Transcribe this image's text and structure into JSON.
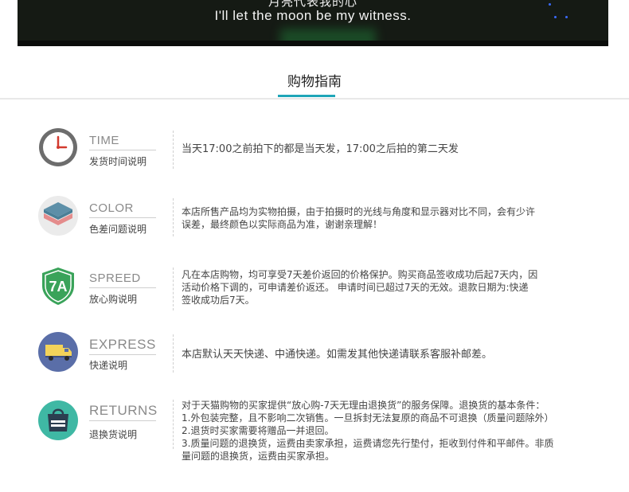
{
  "banner": {
    "subtitle_cn": "月亮代表我的心",
    "subtitle_en": "I'll let the moon be my witness."
  },
  "section": {
    "title": "购物指南"
  },
  "colors": {
    "accent": "#1fa6b8"
  },
  "rows": [
    {
      "icon": "clock-icon",
      "en": "TIME",
      "cn": "发货时间说明",
      "desc": [
        "当天17:00之前拍下的都是当天发，17:00之后拍的第二天发"
      ]
    },
    {
      "icon": "color-layers-icon",
      "en": "COLOR",
      "cn": "色差问题说明",
      "desc": [
        "本店所售产品均为实物拍摄，由于拍摄时的光线与角度和显示器对比不同，会有少许",
        "误差，最终颜色以实际商品为准，谢谢亲理解！"
      ]
    },
    {
      "icon": "seven-day-shield-icon",
      "en": "SPREED",
      "cn": "放心购说明",
      "desc": [
        "凡在本店购物，均可享受7天差价返回的价格保护。购买商品签收成功后起7天内，因",
        "活动价格下调的，可申请差价返还。 申请时间已超过7天的无效。退款日期为:快递",
        "签收成功后7天。"
      ]
    },
    {
      "icon": "delivery-truck-icon",
      "en": "EXPRESS",
      "cn": "快递说明",
      "desc": [
        "本店默认天天快递、中通快递。如需发其他快递请联系客服补邮差。"
      ]
    },
    {
      "icon": "return-bag-icon",
      "en": "RETURNS",
      "cn": "退换货说明",
      "desc": [
        "对于天猫购物的买家提供“放心购-7天无理由退换货”的服务保障。退换货的基本条件：",
        "1.外包装完整，且不影响二次销售。一旦拆封无法复原的商品不可退换（质量问题除外）",
        "2.退货时买家需要将赠品一并退回。",
        "3.质量问题的退换货，运费由卖家承担，运费请您先行垫付，拒收到付件和平邮件。非质",
        "量问题的退换货，运费由买家承担。"
      ]
    }
  ]
}
